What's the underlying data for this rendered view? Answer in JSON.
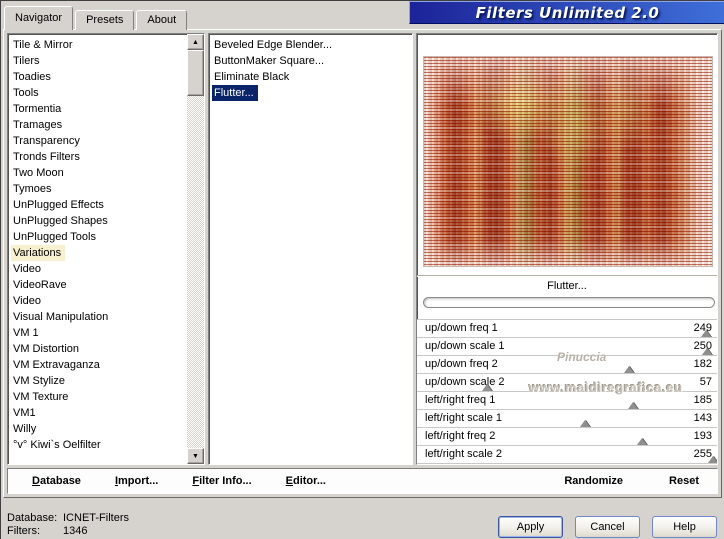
{
  "banner": {
    "title": "Filters Unlimited 2.0",
    "color_left": "#1c2398",
    "color_right": "#3f6fd8"
  },
  "tabs": {
    "items": [
      "Navigator",
      "Presets",
      "About"
    ],
    "active_index": 0
  },
  "category_list": {
    "items": [
      "Tile & Mirror",
      "Tilers",
      "Toadies",
      "Tools",
      "Tormentia",
      "Tramages",
      "Transparency",
      "Tronds Filters",
      "Two Moon",
      "Tymoes",
      "UnPlugged Effects",
      "UnPlugged Shapes",
      "UnPlugged Tools",
      "Variations",
      "Video",
      "VideoRave",
      "Video",
      "Visual Manipulation",
      "VM 1",
      "VM Distortion",
      "VM Extravaganza",
      "VM Stylize",
      "VM Texture",
      "VM1",
      "Willy",
      "°v° Kiwi`s Oelfilter"
    ],
    "selected_index": 13
  },
  "filter_list": {
    "items": [
      "Beveled Edge Blender...",
      "ButtonMaker Square...",
      "Eliminate Black",
      "Flutter..."
    ],
    "selected_index": 3
  },
  "preview": {
    "selected_filter_label": "Flutter..."
  },
  "sliders": {
    "max": 255,
    "items": [
      {
        "label": "up/down freq 1",
        "value": 249
      },
      {
        "label": "up/down scale 1",
        "value": 250
      },
      {
        "label": "up/down freq 2",
        "value": 182
      },
      {
        "label": "up/down scale 2",
        "value": 57
      },
      {
        "label": "left/right freq 1",
        "value": 185
      },
      {
        "label": "left/right scale 1",
        "value": 143
      },
      {
        "label": "left/right freq 2",
        "value": 193
      },
      {
        "label": "left/right scale 2",
        "value": 255
      }
    ]
  },
  "watermark": {
    "line1": "Pinuccia",
    "line2": "www.maidiregrafica.eu"
  },
  "toolbar": {
    "database": "Database",
    "import": "Import...",
    "filter_info": "Filter Info...",
    "editor": "Editor...",
    "randomize": "Randomize",
    "reset": "Reset"
  },
  "status": {
    "database_label": "Database:",
    "database_value": "ICNET-Filters",
    "filters_label": "Filters:",
    "filters_value": "1346"
  },
  "dialog_buttons": {
    "apply": "Apply",
    "cancel": "Cancel",
    "help": "Help"
  },
  "scrollbar_icons": {
    "up": "▲",
    "down": "▼"
  }
}
